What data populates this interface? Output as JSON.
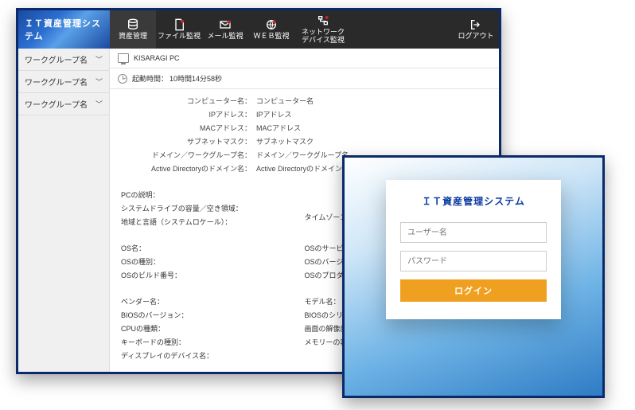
{
  "brand": "ＩＴ資産管理システム",
  "nav": [
    {
      "label": "資産管理",
      "icon": "db"
    },
    {
      "label": "ファイル監視",
      "icon": "doc"
    },
    {
      "label": "メール監視",
      "icon": "mail"
    },
    {
      "label": "ＷＥＢ監視",
      "icon": "globe"
    },
    {
      "label": "ネットワーク\nデバイス監視",
      "icon": "net"
    }
  ],
  "logout": "ログアウト",
  "sidebar": [
    {
      "label": "ワークグループ名"
    },
    {
      "label": "ワークグループ名"
    },
    {
      "label": "ワークグループ名"
    }
  ],
  "pc_name": "KISARAGI PC",
  "uptime_label": "起動時間：",
  "uptime_value": "10時間14分58秒",
  "props1": [
    {
      "k": "コンピューター名：",
      "v": "コンピューター名"
    },
    {
      "k": "IPアドレス：",
      "v": "IPアドレス"
    },
    {
      "k": "MACアドレス：",
      "v": "MACアドレス"
    },
    {
      "k": "サブネットマスク：",
      "v": "サブネットマスク"
    },
    {
      "k": "ドメイン／ワークグループ名：",
      "v": "ドメイン／ワークグループ名"
    },
    {
      "k": "Active Directoryのドメイン名：",
      "v": "Active Directoryのドメイン名"
    }
  ],
  "block2_left": [
    "PCの説明：",
    "システムドライブの容量／空き領域：",
    "地域と言語（システムロケール）："
  ],
  "block2_right": [
    "タイムゾーン："
  ],
  "block3_left": [
    "OS名：",
    "OSの種別：",
    "OSのビルド番号："
  ],
  "block3_right": [
    "OSのサービスパック名：",
    "OSのバージョン：",
    "OSのプロダクトID："
  ],
  "block4_left": [
    "ベンダー名：",
    "BIOSのバージョン：",
    "CPUの種類：",
    "キーボードの種別：",
    "ディスプレイのデバイス名："
  ],
  "block4_right": [
    "モデル名：",
    "BIOSのシリアル番号：",
    "画面の解像度：",
    "メモリーの容量："
  ],
  "login": {
    "title": "ＩＴ資産管理システム",
    "user_ph": "ユーザー名",
    "pass_ph": "パスワード",
    "button": "ログイン"
  }
}
